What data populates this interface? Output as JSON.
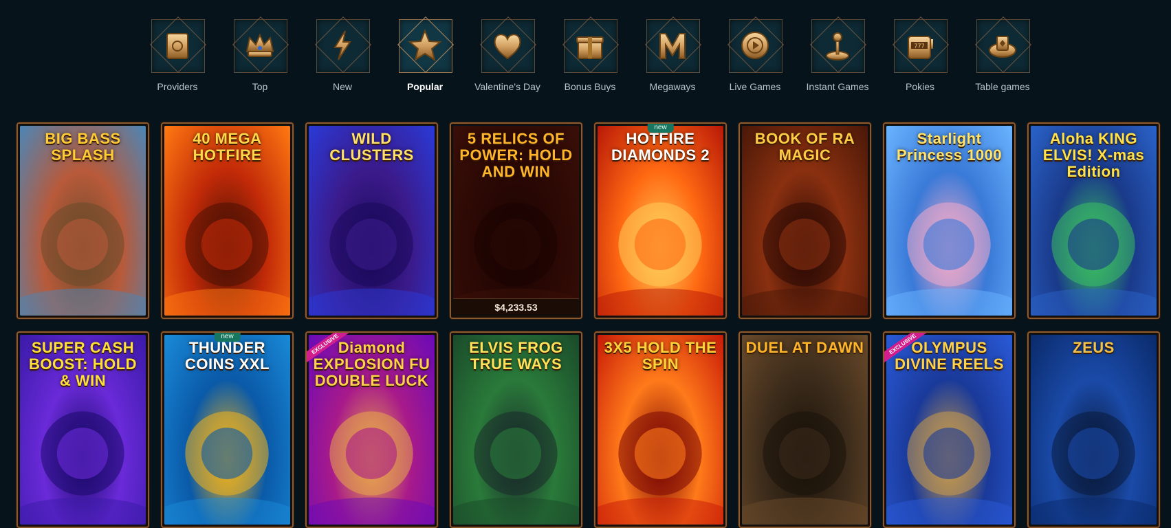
{
  "categories": [
    {
      "label": "Providers",
      "icon": "book-icon",
      "active": false
    },
    {
      "label": "Top",
      "icon": "crown-icon",
      "active": false
    },
    {
      "label": "New",
      "icon": "lightning-icon",
      "active": false
    },
    {
      "label": "Popular",
      "icon": "star-icon",
      "active": true
    },
    {
      "label": "Valentine's Day",
      "icon": "heart-icon",
      "active": false
    },
    {
      "label": "Bonus Buys",
      "icon": "gift-icon",
      "active": false
    },
    {
      "label": "Megaways",
      "icon": "m-letter-icon",
      "active": false
    },
    {
      "label": "Live Games",
      "icon": "chip-icon",
      "active": false
    },
    {
      "label": "Instant Games",
      "icon": "joystick-icon",
      "active": false
    },
    {
      "label": "Pokies",
      "icon": "slot-machine-icon",
      "active": false
    },
    {
      "label": "Table games",
      "icon": "card-table-icon",
      "active": false
    }
  ],
  "games": [
    {
      "title": "BIG BASS SPLASH",
      "badge": "",
      "jackpot": "",
      "colors": [
        "#4a86b8",
        "#b85a3a",
        "#6a4a2a"
      ],
      "title_color": "#ffcc33"
    },
    {
      "title": "40 MEGA HOTFIRE",
      "badge": "",
      "jackpot": "",
      "colors": [
        "#ff7a12",
        "#c22a08",
        "#4a1004"
      ],
      "title_color": "#ffd84a"
    },
    {
      "title": "WILD CLUSTERS",
      "badge": "",
      "jackpot": "",
      "colors": [
        "#2a3ad8",
        "#3b1a8a",
        "#1a0a5a"
      ],
      "title_color": "#ffe16a"
    },
    {
      "title": "5 RELICS OF POWER: HOLD AND WIN",
      "badge": "",
      "jackpot": "$4,233.53",
      "colors": [
        "#3a0f08",
        "#2a0804",
        "#1a0402"
      ],
      "title_color": "#ffb52a"
    },
    {
      "title": "HOTFIRE DIAMONDS 2",
      "badge": "new",
      "jackpot": "",
      "colors": [
        "#b81808",
        "#ff6a12",
        "#ffcc5a"
      ],
      "title_color": "#ffffff"
    },
    {
      "title": "BOOK OF RA MAGIC",
      "badge": "",
      "jackpot": "",
      "colors": [
        "#4a1808",
        "#8a3010",
        "#2a0a04"
      ],
      "title_color": "#ffcc44"
    },
    {
      "title": "Starlight Princess 1000",
      "badge": "",
      "jackpot": "",
      "colors": [
        "#6ab4ff",
        "#3a7ad8",
        "#f2a9c8"
      ],
      "title_color": "#ffe36a"
    },
    {
      "title": "Aloha KING ELVIS! X-mas Edition",
      "badge": "",
      "jackpot": "",
      "colors": [
        "#2a62c8",
        "#1a3a8a",
        "#3ac060"
      ],
      "title_color": "#ffe24a"
    },
    {
      "title": "SUPER CASH BOOST: HOLD & WIN",
      "badge": "",
      "jackpot": "",
      "colors": [
        "#3a1aa8",
        "#6a2ad8",
        "#1a0a6a"
      ],
      "title_color": "#ffe03a"
    },
    {
      "title": "THUNDER COINS XXL",
      "badge": "new",
      "jackpot": "",
      "colors": [
        "#1a8ad8",
        "#0a5aa8",
        "#f2b21a"
      ],
      "title_color": "#ffffff"
    },
    {
      "title": "Diamond EXPLOSION FU DOUBLE LUCK",
      "badge": "EXCLUSIVE",
      "jackpot": "",
      "colors": [
        "#6a0ab8",
        "#a81a8a",
        "#e8a84a"
      ],
      "title_color": "#ffd24a"
    },
    {
      "title": "ELVIS FROG TRUE WAYS",
      "badge": "",
      "jackpot": "",
      "colors": [
        "#1a4a2a",
        "#2a7a3a",
        "#1a2a2a"
      ],
      "title_color": "#ffe15a"
    },
    {
      "title": "3X5 HOLD THE SPIN",
      "badge": "",
      "jackpot": "",
      "colors": [
        "#c81a08",
        "#ff7a1a",
        "#7a0804"
      ],
      "title_color": "#ffd23a"
    },
    {
      "title": "DUEL AT DAWN",
      "badge": "",
      "jackpot": "",
      "colors": [
        "#6a4a2a",
        "#3a2a1a",
        "#1a120a"
      ],
      "title_color": "#ffb52a"
    },
    {
      "title": "OLYMPUS DIVINE REELS",
      "badge": "EXCLUSIVE",
      "jackpot": "",
      "colors": [
        "#2a5ad8",
        "#1a3a9a",
        "#c89a4a"
      ],
      "title_color": "#ffd24a"
    },
    {
      "title": "ZEUS",
      "badge": "",
      "jackpot": "",
      "colors": [
        "#0a2a6a",
        "#1a4aa8",
        "#0a1a3a"
      ],
      "title_color": "#f2c24a"
    }
  ]
}
